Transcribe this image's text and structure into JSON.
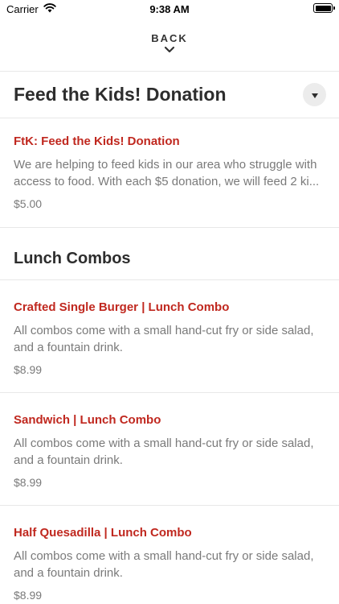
{
  "status_bar": {
    "carrier": "Carrier",
    "time": "9:38 AM"
  },
  "header": {
    "back_label": "BACK"
  },
  "sections": [
    {
      "title": "Feed the Kids! Donation",
      "items": [
        {
          "name": "FtK: Feed the Kids! Donation",
          "desc_line1": "We are helping to feed kids in our area who struggle with",
          "desc_line2": "access to food. With each $5 donation, we will feed 2 ki...",
          "price": "$5.00"
        }
      ]
    },
    {
      "title": "Lunch Combos",
      "items": [
        {
          "name": "Crafted Single Burger | Lunch Combo",
          "desc_line1": "All combos come with a small hand-cut fry or side salad,",
          "desc_line2": "and a fountain drink.",
          "price": "$8.99"
        },
        {
          "name": "Sandwich | Lunch Combo",
          "desc_line1": "All combos come with a small hand-cut fry or side salad,",
          "desc_line2": "and a fountain drink.",
          "price": "$8.99"
        },
        {
          "name": "Half Quesadilla | Lunch Combo",
          "desc_line1": "All combos come with a small hand-cut fry or side salad,",
          "desc_line2": "and a fountain drink.",
          "price": "$8.99"
        }
      ]
    }
  ],
  "colors": {
    "accent": "#c0281f",
    "text": "#2d2d2d",
    "muted": "#7a7a7a",
    "divider": "#e8e8e8"
  },
  "icons": [
    "wifi-icon",
    "battery-icon",
    "chevron-down-icon",
    "dropdown-triangle-icon"
  ]
}
